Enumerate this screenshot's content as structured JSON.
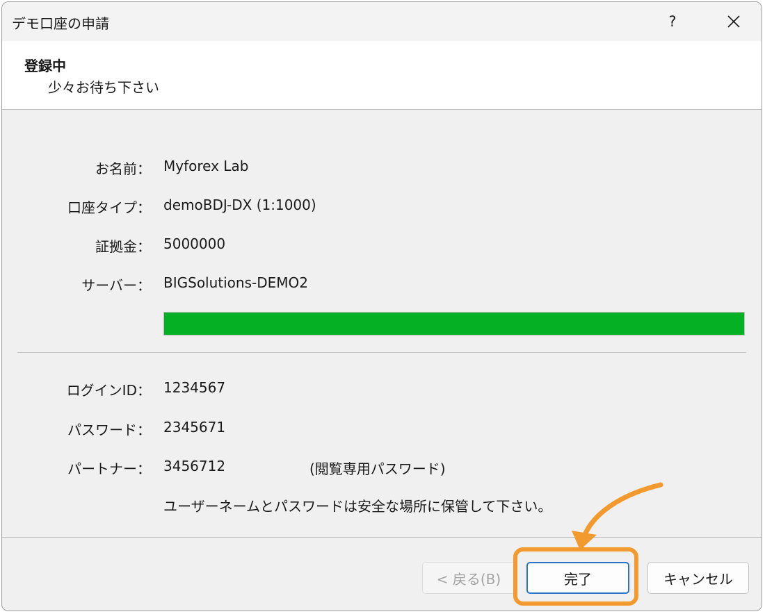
{
  "window": {
    "title": "デモ口座の申請",
    "help_label": "?"
  },
  "header": {
    "title": "登録中",
    "subtitle": "少々お待ち下さい"
  },
  "account_info": [
    {
      "label": "お名前：",
      "value": "Myforex Lab"
    },
    {
      "label": "口座タイプ：",
      "value": "demoBDJ-DX (1:1000)"
    },
    {
      "label": "証拠金：",
      "value": "5000000"
    },
    {
      "label": "サーバー：",
      "value": "BIGSolutions-DEMO2"
    }
  ],
  "progress": {
    "percent": 100,
    "color": "#06b025"
  },
  "credentials": [
    {
      "label": "ログインID：",
      "value": "1234567"
    },
    {
      "label": "パスワード：",
      "value": "2345671"
    },
    {
      "label": "パートナー：",
      "value": "3456712"
    }
  ],
  "partner_note": "(閲覧専用パスワード)",
  "save_note": "ユーザーネームとパスワードは安全な場所に保管して下さい。",
  "buttons": {
    "back": "< 戻る(B)",
    "finish": "完了",
    "cancel": "キャンセル"
  },
  "highlight_color": "#f29a2e",
  "icons": {
    "close": "close-icon",
    "help": "help-icon"
  }
}
